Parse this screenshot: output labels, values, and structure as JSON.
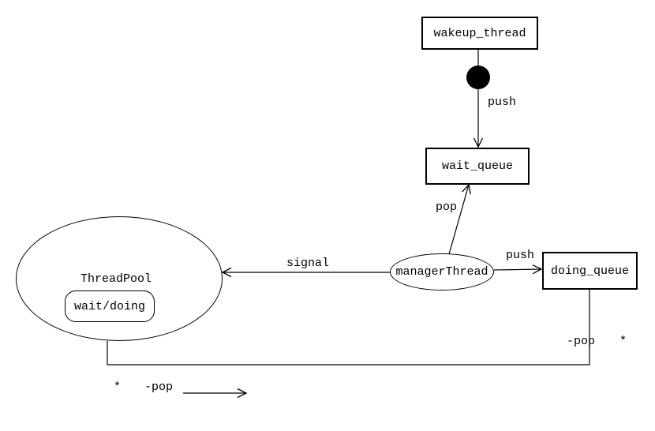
{
  "nodes": {
    "wakeup_thread": "wakeup_thread",
    "wait_queue": "wait_queue",
    "manager_thread": "managerThread",
    "doing_queue": "doing_queue",
    "thread_pool": "ThreadPool",
    "wait_doing": "wait/doing"
  },
  "edges": {
    "push1": "push",
    "pop1": "pop",
    "push2": "push",
    "signal": "signal",
    "pop2_a": "-pop",
    "pop2_b": "-pop",
    "star_a": "*",
    "star_b": "*"
  },
  "chart_data": {
    "type": "diagram",
    "title": "",
    "nodes": [
      {
        "id": "wakeup_thread",
        "label": "wakeup_thread",
        "shape": "rect"
      },
      {
        "id": "solid_dot",
        "label": "",
        "shape": "filled-circle"
      },
      {
        "id": "wait_queue",
        "label": "wait_queue",
        "shape": "rect"
      },
      {
        "id": "manager_thread",
        "label": "managerThread",
        "shape": "ellipse"
      },
      {
        "id": "doing_queue",
        "label": "doing_queue",
        "shape": "rect"
      },
      {
        "id": "thread_pool",
        "label": "ThreadPool",
        "shape": "ellipse",
        "children": [
          {
            "id": "wait_doing",
            "label": "wait/doing",
            "shape": "rounded-rect"
          }
        ]
      }
    ],
    "edges": [
      {
        "from": "wakeup_thread",
        "to": "solid_dot",
        "label": "",
        "arrow": false
      },
      {
        "from": "solid_dot",
        "to": "wait_queue",
        "label": "push",
        "arrow": true
      },
      {
        "from": "manager_thread",
        "to": "wait_queue",
        "label": "pop",
        "arrow": true
      },
      {
        "from": "manager_thread",
        "to": "doing_queue",
        "label": "push",
        "arrow": true
      },
      {
        "from": "manager_thread",
        "to": "thread_pool",
        "label": "signal",
        "arrow": true
      },
      {
        "from": "doing_queue",
        "to": "thread_pool",
        "label": "-pop",
        "end_label": "*",
        "arrow": true,
        "style": "association"
      }
    ]
  }
}
